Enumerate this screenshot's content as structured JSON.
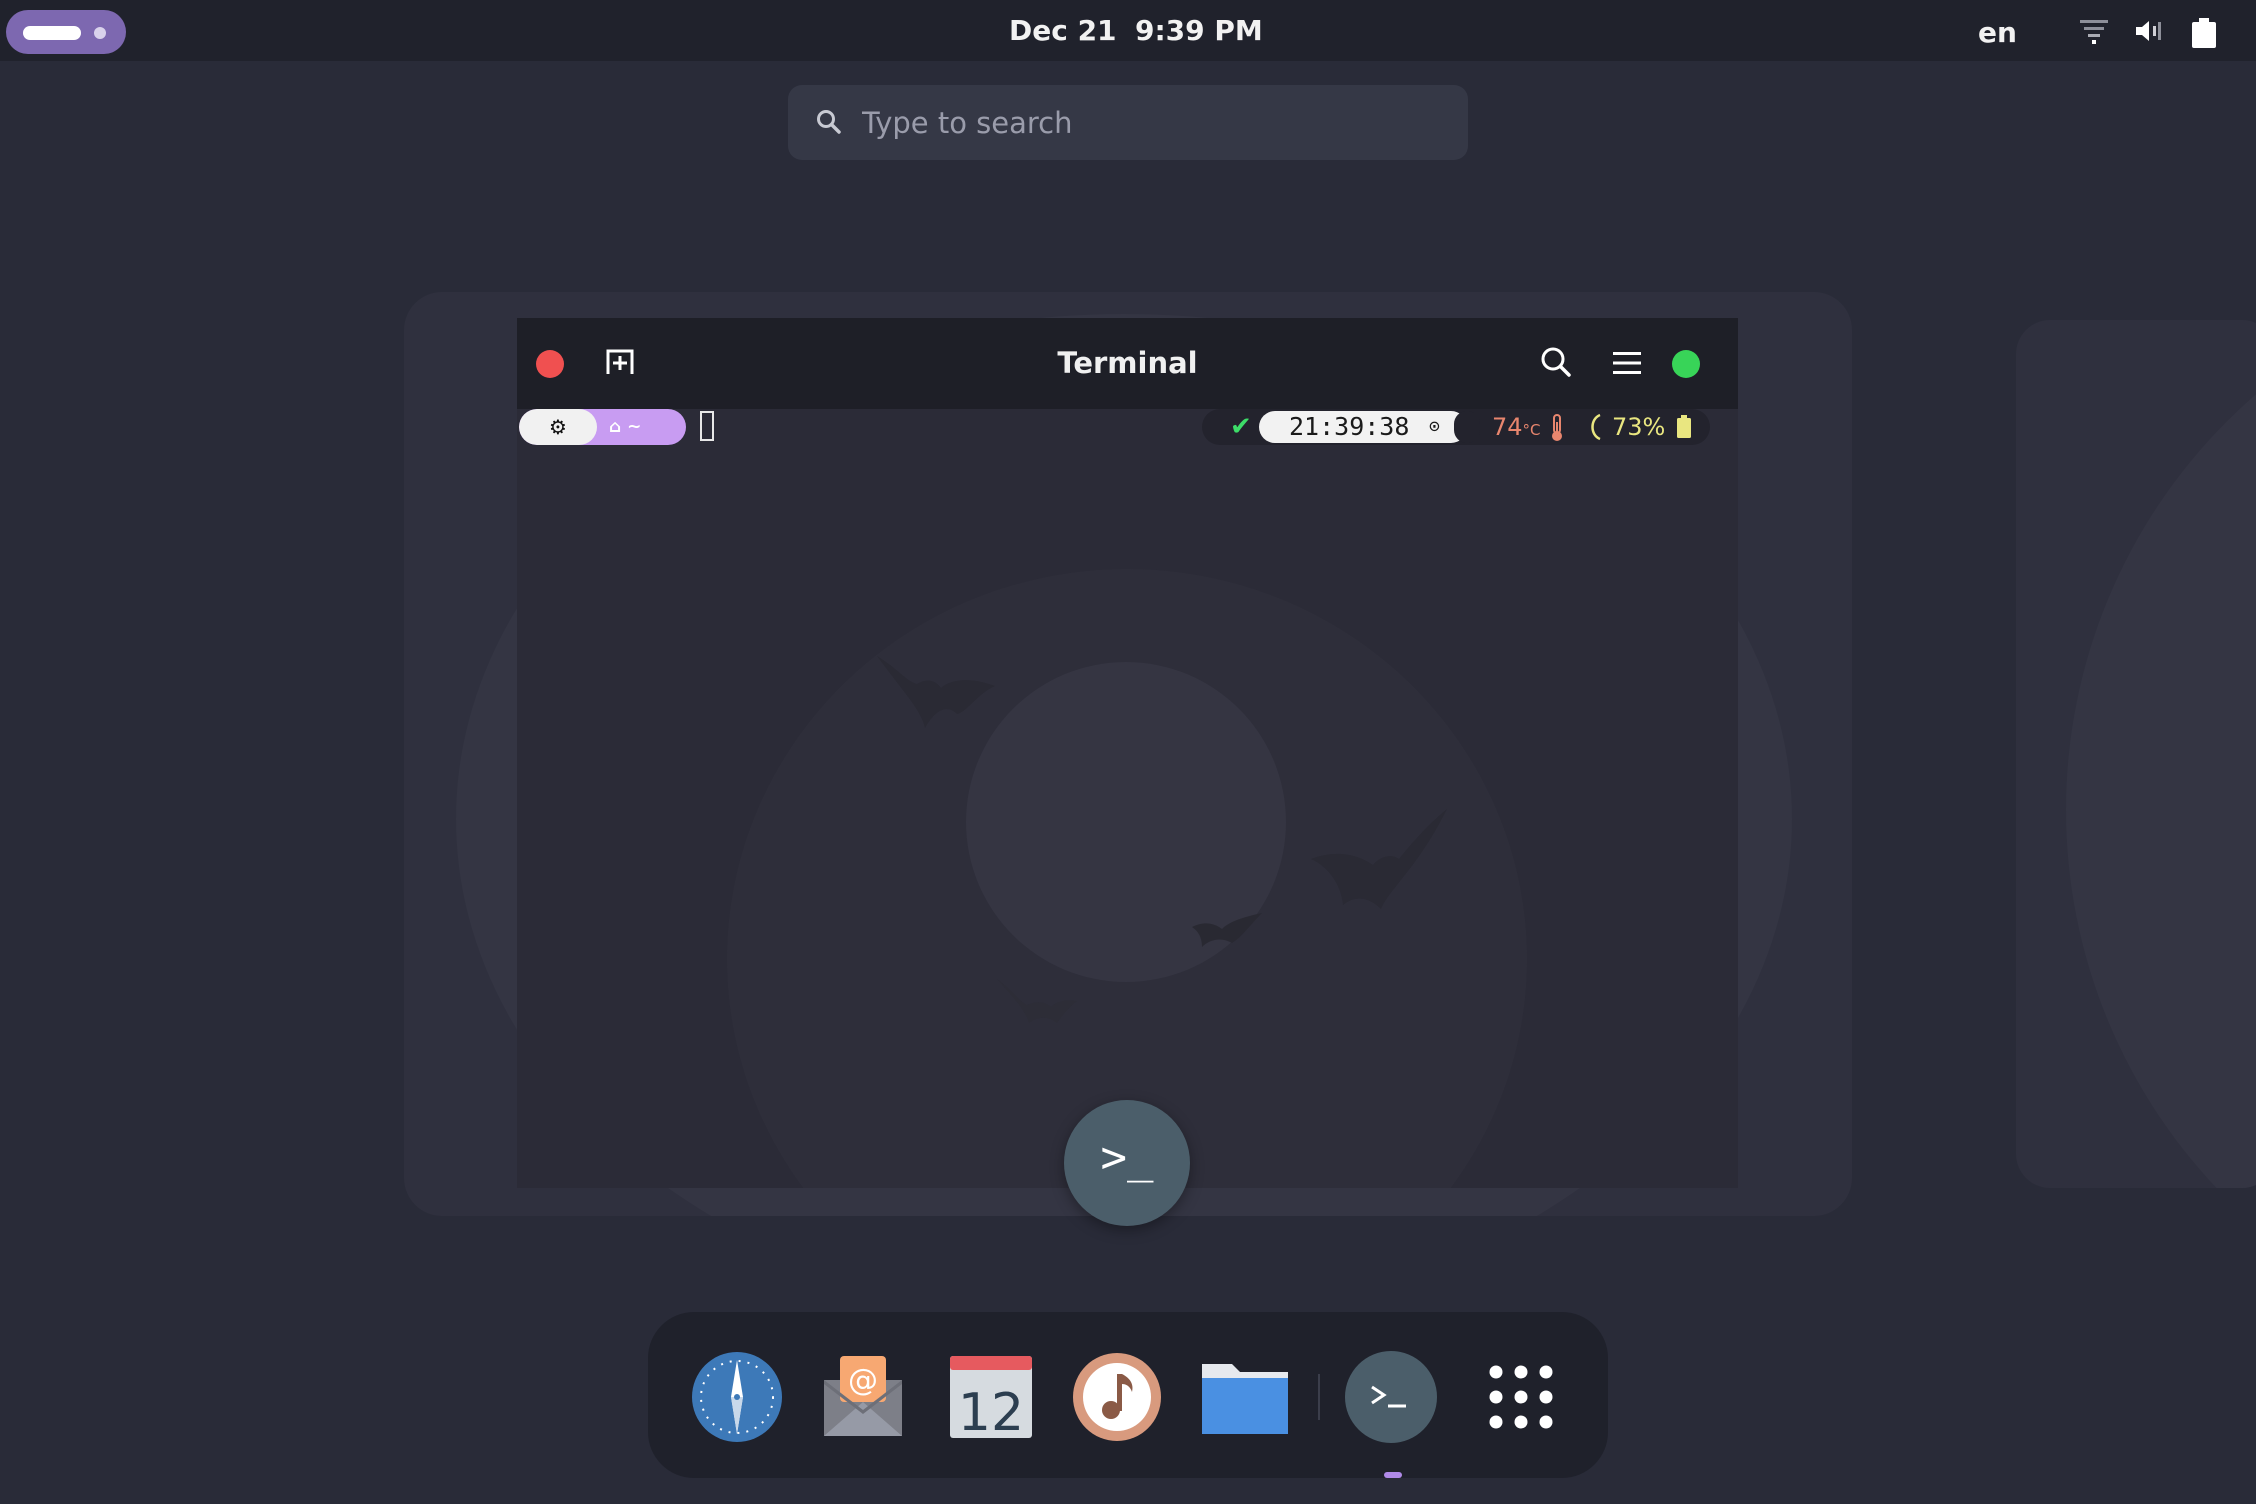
{
  "topbar": {
    "date": "Dec 21",
    "time": "9:39 PM",
    "keyboard_layout": "en",
    "tray_icons": [
      "network-icon",
      "volume-icon",
      "battery-icon"
    ]
  },
  "search": {
    "placeholder": "Type to search"
  },
  "terminal": {
    "title": "Terminal",
    "prompt": {
      "left_icon": "gear-icon",
      "path_home_icon": "home-icon",
      "path": "~",
      "status_check": "✔",
      "time": "21:39:38",
      "temperature": "74",
      "temperature_unit": "°C",
      "battery": "73%"
    },
    "app_badge": ">_"
  },
  "dock": {
    "apps": [
      "web-browser",
      "mail",
      "calendar",
      "music",
      "files",
      "terminal",
      "show-applications"
    ],
    "calendar_day": "12",
    "running_app": "terminal"
  },
  "colors": {
    "activities": "#7d68b0",
    "close_button": "#f05050",
    "maximize_button": "#38d458",
    "check_green": "#3ddc68",
    "temperature": "#e8866e",
    "battery_text": "#e9e680",
    "prompt_purple": "#c89cf2"
  }
}
